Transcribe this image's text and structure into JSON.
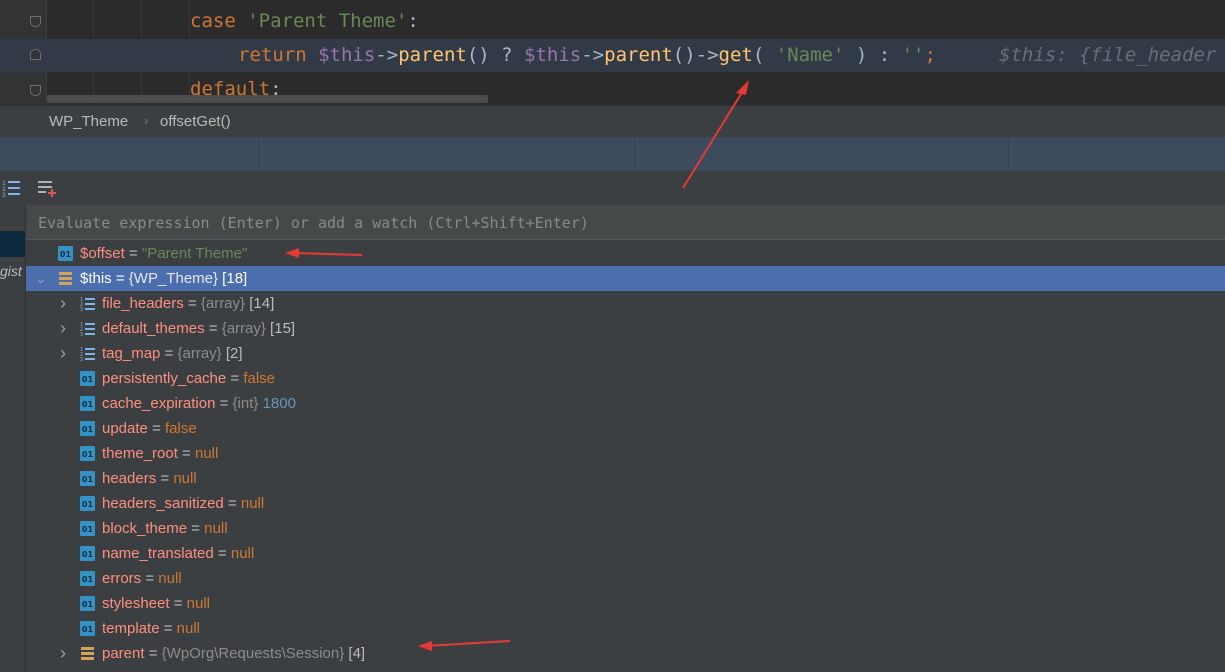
{
  "editor": {
    "line_case": [
      "case",
      " ",
      "'Parent Theme'",
      ":"
    ],
    "line_return": [
      "return",
      " ",
      "$this",
      "->",
      "parent",
      "() ? ",
      "$this",
      "->",
      "parent",
      "()->",
      "get",
      "( ",
      "'Name'",
      " ) : ",
      "''",
      ";"
    ],
    "inline_hint": "$this: {file_header",
    "line_default": [
      "default",
      ":"
    ]
  },
  "breadcrumb": {
    "class_name": "WP_Theme",
    "separator": "›",
    "method": "offsetGet()"
  },
  "left_panel": {
    "clipped_text": "gist"
  },
  "evaluate": {
    "placeholder": "Evaluate expression (Enter) or add a watch (Ctrl+Shift+Enter)"
  },
  "variables": {
    "offset": {
      "name": "$offset",
      "eq": " = ",
      "value": "\"Parent Theme\""
    },
    "this": {
      "name": "$this",
      "eq": " = ",
      "type": "{WP_Theme}",
      "count": " [18]"
    },
    "children": [
      {
        "name": "file_headers",
        "eq": " = ",
        "type": "{array}",
        "count": " [14]"
      },
      {
        "name": "default_themes",
        "eq": " = ",
        "type": "{array}",
        "count": " [15]"
      },
      {
        "name": "tag_map",
        "eq": " = ",
        "type": "{array}",
        "count": " [2]"
      },
      {
        "name": "persistently_cache",
        "eq": " = ",
        "value": "false"
      },
      {
        "name": "cache_expiration",
        "eq": " = ",
        "type": "{int}",
        "value": " 1800"
      },
      {
        "name": "update",
        "eq": " = ",
        "value": "false"
      },
      {
        "name": "theme_root",
        "eq": " = ",
        "value": "null"
      },
      {
        "name": "headers",
        "eq": " = ",
        "value": "null"
      },
      {
        "name": "headers_sanitized",
        "eq": " = ",
        "value": "null"
      },
      {
        "name": "block_theme",
        "eq": " = ",
        "value": "null"
      },
      {
        "name": "name_translated",
        "eq": " = ",
        "value": "null"
      },
      {
        "name": "errors",
        "eq": " = ",
        "value": "null"
      },
      {
        "name": "stylesheet",
        "eq": " = ",
        "value": "null"
      },
      {
        "name": "template",
        "eq": " = ",
        "value": "null"
      },
      {
        "name": "parent",
        "eq": " = ",
        "type": "{WpOrg\\Requests\\Session}",
        "count": " [4]"
      }
    ]
  },
  "colors": {
    "annotation_arrow": "#e53935",
    "selection": "#4b6eaf",
    "var_name": "#ff8f80",
    "keyword": "#cc7832",
    "string": "#6a8759",
    "number": "#6897bb"
  },
  "icons": {
    "primitive": "primitive-value-icon",
    "object": "object-icon",
    "array": "array-icon"
  }
}
